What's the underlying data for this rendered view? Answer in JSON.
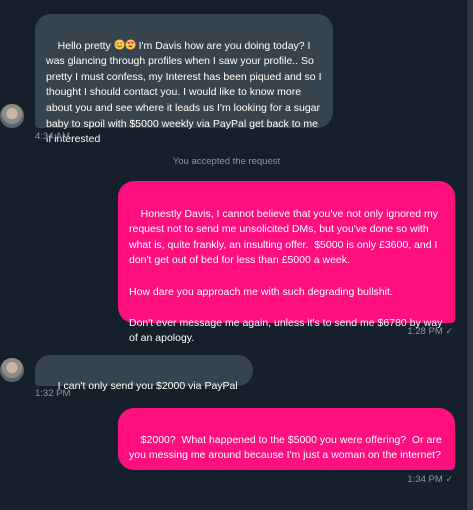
{
  "messages": [
    {
      "sender": "other",
      "text_parts": [
        "Hello pretty ",
        " I'm Davis how are you doing today? I was glancing through profiles when I saw your profile.. So pretty I must confess, my Interest has been piqued and so I thought I should contact you. I would like to know more about you and see where it leads us I'm looking for a sugar baby to spoil with $5000 weekly via PayPal get back to me if interested"
      ],
      "emojis": [
        "smiling-face-with-hearts-icon",
        "heart-eyes-icon"
      ],
      "time": "4:34 AM"
    },
    {
      "sender": "me",
      "text": "Honestly Davis, I cannot believe that you've not only ignored my request not to send me unsolicited DMs, but you've done so with what is, quite frankly, an insulting offer.  $5000 is only £3600, and I don't get out of bed for less than £5000 a week.\n\nHow dare you approach me with such degrading bullshit.\n\nDon't ever message me again, unless it's to send me $6780 by way of an apology.",
      "time": "1:28 PM"
    },
    {
      "sender": "other",
      "text": "I can't only send you $2000 via PayPal",
      "time": "1:32 PM"
    },
    {
      "sender": "me",
      "text": "$2000?  What happened to the $5000 you were offering?  Or are you messing me around because I'm just a woman on the internet?",
      "time": "1:34 PM"
    }
  ],
  "system_notice": "You accepted the request",
  "colors": {
    "background": "#15202b",
    "incoming_bubble": "#38444d",
    "outgoing_bubble": "#ff0f7f",
    "meta_text": "#8899a6"
  }
}
